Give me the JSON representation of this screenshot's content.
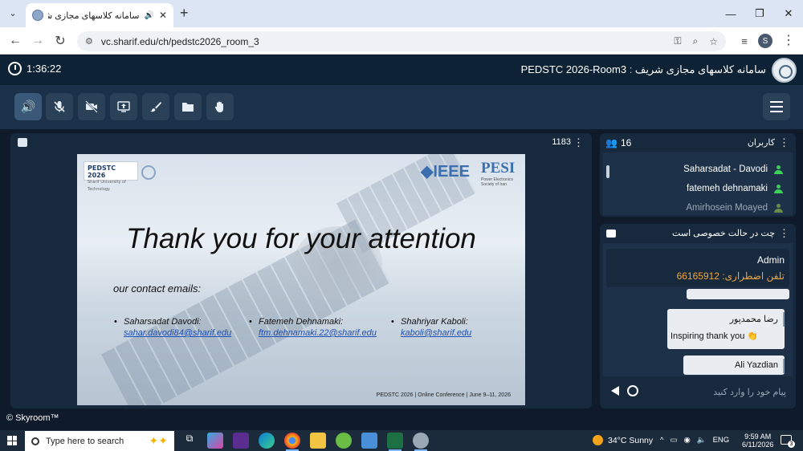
{
  "browser": {
    "tab_title": "سامانه کلاسهای مجازی شریف - ...",
    "url": "vc.sharif.edu/ch/pedstc2026_room_3",
    "profile_initial": "S"
  },
  "app": {
    "timer": "1:36:22",
    "title": "سامانه کلاسهای مجازی شریف : PEDSTC 2026-Room3"
  },
  "presentation": {
    "count": "1183",
    "slide": {
      "logo_left": "PEDSTC 2026",
      "logo_left_sub": "Sharif University of Technology",
      "logo_ieee": "IEEE",
      "logo_pesi": "PESI",
      "logo_pesi_sub": "Power Electronics Society of Iran",
      "heading": "Thank you for your attention",
      "contact_label": "our contact emails:",
      "contacts": [
        {
          "name": "Saharsadat Davodi:",
          "email": "sahar.davodi84@sharif.edu"
        },
        {
          "name": "Fatemeh Dehnamaki:",
          "email": "ftm.dehnamaki.22@sharif.edu"
        },
        {
          "name": "Shahriyar Kaboli:",
          "email": "kaboli@sharif.edu"
        }
      ],
      "footer": "PEDSTC 2026 | Online Conference | June 9–11, 2026"
    }
  },
  "users": {
    "title": "کاربران",
    "count": "16",
    "items": [
      {
        "name": "Saharsadat - Davodi"
      },
      {
        "name": "fatemeh dehnamaki"
      },
      {
        "name": "Amirhosein Moayed"
      }
    ]
  },
  "chat": {
    "title": "چت در حالت خصوصی است",
    "pinned_sender": "Admin",
    "pinned_text": "تلفن اضطراری: 66165912",
    "messages": [
      {
        "sender": "رضا محمدپور",
        "text": "Inspiring thank you 👏"
      },
      {
        "sender": "Ali Yazdian"
      }
    ],
    "input_placeholder": "پیام خود را وارد کنید"
  },
  "footer": {
    "copyright": "© Skyroom™"
  },
  "taskbar": {
    "search_placeholder": "Type here to search",
    "weather": "34°C  Sunny",
    "lang": "ENG",
    "time": "9:59 AM",
    "date": "6/11/2026",
    "notifications": "3"
  },
  "colors": {
    "app_header": "#0e2235",
    "toolbar": "#1a3149",
    "panel": "#16293d",
    "active_icon": "#6cc4ff",
    "emergency_text": "#f2a73a",
    "user_online": "#3dcf5a"
  }
}
